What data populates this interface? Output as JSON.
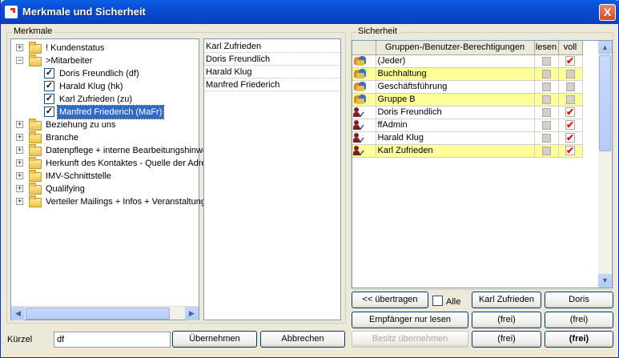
{
  "window": {
    "title": "Merkmale und Sicherheit",
    "close_label": "X"
  },
  "merkmale": {
    "legend": "Merkmale",
    "tree": [
      {
        "label": "! Kundenstatus",
        "type": "folder",
        "expand": "+"
      },
      {
        "label": ">Mitarbeiter",
        "type": "folder",
        "expand": "−"
      },
      {
        "label": "Doris Freundlich (df)",
        "type": "check",
        "checked": "✓"
      },
      {
        "label": "Harald Klug (hk)",
        "type": "check",
        "checked": "✓"
      },
      {
        "label": "Karl Zufrieden (zu)",
        "type": "check",
        "checked": "✓"
      },
      {
        "label": "Manfred Friederich (MaFr)",
        "type": "check",
        "checked": "✓",
        "selected": true
      },
      {
        "label": "Beziehung zu uns",
        "type": "folder",
        "expand": "+"
      },
      {
        "label": "Branche",
        "type": "folder",
        "expand": "+"
      },
      {
        "label": "Datenpflege + interne Bearbeitungshinwe",
        "type": "folder",
        "expand": "+"
      },
      {
        "label": "Herkunft des Kontaktes - Quelle der Adre",
        "type": "folder",
        "expand": "+"
      },
      {
        "label": "IMV-Schnittstelle",
        "type": "folder",
        "expand": "+"
      },
      {
        "label": "Qualifying",
        "type": "folder",
        "expand": "+"
      },
      {
        "label": "Verteiler Mailings + Infos + Veranstaltung",
        "type": "folder",
        "expand": "+"
      }
    ],
    "selected_list": [
      "Karl Zufrieden",
      "Doris Freundlich",
      "Harald Klug",
      "Manfred Friederich"
    ]
  },
  "kuerzel": {
    "label": "Kürzel",
    "value": "df"
  },
  "buttons": {
    "uebernehmen": "Übernehmen",
    "abbrechen": "Abbrechen",
    "uebertragen": "<< übertragen",
    "alle": "Alle",
    "karl": "Karl Zufrieden",
    "doris": "Doris",
    "empfaenger": "Empfänger nur lesen",
    "frei1": "(frei)",
    "frei2": "(frei)",
    "besitz": "Besitz übernehmen",
    "frei3": "(frei)",
    "frei4": "(frei)"
  },
  "sicherheit": {
    "legend": "Sicherheit",
    "columns": [
      "Gruppen-/Benutzer-Berechtigungen",
      "lesen",
      "voll"
    ],
    "rows": [
      {
        "name": "(Jeder)",
        "icon": "group-icon",
        "highlight": false,
        "voll": "✔"
      },
      {
        "name": "Buchhaltung",
        "icon": "group-icon",
        "highlight": true,
        "voll": ""
      },
      {
        "name": "Geschäftsführung",
        "icon": "group-icon",
        "highlight": false,
        "voll": ""
      },
      {
        "name": "Gruppe B",
        "icon": "group-icon",
        "highlight": true,
        "voll": ""
      },
      {
        "name": "Doris Freundlich",
        "icon": "user-check-icon",
        "highlight": false,
        "voll": "✔"
      },
      {
        "name": "ffAdmin",
        "icon": "user-check-icon",
        "highlight": false,
        "voll": "✔"
      },
      {
        "name": "Harald Klug",
        "icon": "user-check-icon",
        "highlight": false,
        "voll": "✔"
      },
      {
        "name": "Karl Zufrieden",
        "icon": "user-check-icon",
        "highlight": true,
        "voll": "✔"
      }
    ]
  },
  "colors": {
    "title_blue": "#0a4ad0",
    "selection": "#316ac5",
    "highlight_yellow": "#ffff99",
    "check_red": "#e01010"
  }
}
